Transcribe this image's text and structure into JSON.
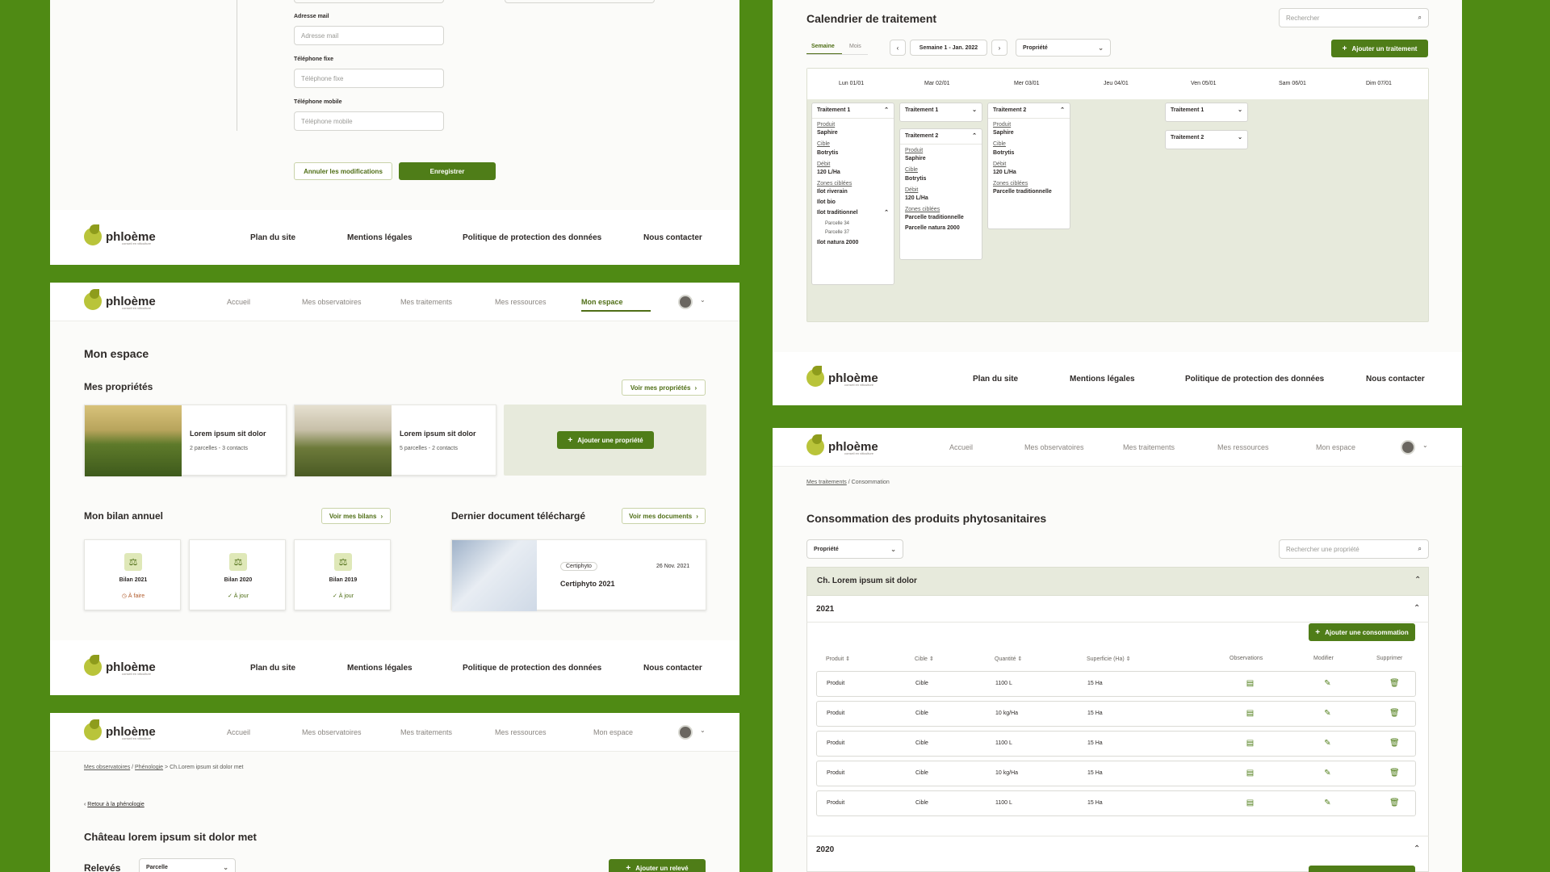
{
  "colors": {
    "background": "#4f8a14",
    "accent": "#4f7d18"
  },
  "brand": {
    "name": "phloème",
    "tagline": "conseil en viticulture"
  },
  "footer": {
    "links": [
      "Plan du site",
      "Mentions légales",
      "Politique de protection des données",
      "Nous contacter"
    ]
  },
  "nav": {
    "links": [
      "Accueil",
      "Mes observatoires",
      "Mes traitements",
      "Mes ressources",
      "Mon espace"
    ],
    "active": "Mon espace"
  },
  "form": {
    "email_label": "Adresse mail",
    "email_placeholder": "Adresse mail",
    "phone_label": "Téléphone fixe",
    "phone_placeholder": "Téléphone fixe",
    "mobile_label": "Téléphone mobile",
    "mobile_placeholder": "Téléphone mobile",
    "cancel": "Annuler les modifications",
    "save": "Enregistrer"
  },
  "espace": {
    "title": "Mon espace",
    "properties_title": "Mes propriétés",
    "see_properties": "Voir mes propriétés",
    "properties": [
      {
        "name": "Lorem ipsum sit dolor",
        "meta": "2 parcelles - 3 contacts"
      },
      {
        "name": "Lorem ipsum sit dolor",
        "meta": "5 parcelles - 2 contacts"
      }
    ],
    "add_property": "Ajouter une propriété",
    "bilan_title": "Mon bilan annuel",
    "see_bilans": "Voir mes bilans",
    "bilans": [
      {
        "name": "Bilan 2021",
        "status": "À faire"
      },
      {
        "name": "Bilan 2020",
        "status": "À jour"
      },
      {
        "name": "Bilan 2019",
        "status": "À jour"
      }
    ],
    "doc_title": "Dernier document téléchargé",
    "see_docs": "Voir mes documents",
    "doc": {
      "tag": "Certiphyto",
      "date": "26 Nov. 2021",
      "name": "Certiphyto 2021"
    }
  },
  "pheno": {
    "breadcrumb": [
      "Mes observatoires",
      "Phénologie",
      "Ch.Lorem ipsum sit dolor met"
    ],
    "back": "Retour à la phénologie",
    "title": "Château lorem ipsum sit dolor met",
    "releves": "Relevés",
    "select": "Parcelle",
    "add": "Ajouter un relevé"
  },
  "calendar": {
    "title": "Calendrier de traitement",
    "search_placeholder": "Rechercher",
    "tab_week": "Semaine",
    "tab_month": "Mois",
    "week_label": "Semaine 1 - Jan. 2022",
    "property_select": "Propriété",
    "add": "Ajouter un traitement",
    "days": [
      "Lun 01/01",
      "Mar 02/01",
      "Mer 03/01",
      "Jeu 04/01",
      "Ven 05/01",
      "Sam 06/01",
      "Dim 07/01"
    ],
    "card1": {
      "title": "Traitement 1",
      "product_label": "Produit",
      "product": "Saphire",
      "target_label": "Cible",
      "target": "Botrytis",
      "rate_label": "Débit",
      "rate": "120 L/Ha",
      "zones_label": "Zones ciblées",
      "zones": [
        "Ilot riverain",
        "Ilot bio",
        "Ilot traditionnel"
      ],
      "parcels": [
        "Parcelle 34",
        "Parcelle 37"
      ],
      "last_zone": "Ilot natura 2000"
    },
    "card2a": {
      "title": "Traitement 1"
    },
    "card2b": {
      "title": "Traitement 2",
      "product_label": "Produit",
      "product": "Saphire",
      "target_label": "Cible",
      "target": "Botrytis",
      "rate_label": "Débit",
      "rate": "120 L/Ha",
      "zones_label": "Zones ciblées",
      "zones": [
        "Parcelle traditionnelle",
        "Parcelle natura 2000"
      ]
    },
    "card3": {
      "title": "Traitement 2",
      "product_label": "Produit",
      "product": "Saphire",
      "target_label": "Cible",
      "target": "Botrytis",
      "rate_label": "Débit",
      "rate": "120 L/Ha",
      "zones_label": "Zones ciblées",
      "zones": [
        "Parcelle traditionnelle"
      ]
    },
    "card5a": {
      "title": "Traitement 1"
    },
    "card5b": {
      "title": "Traitement 2"
    }
  },
  "conso": {
    "breadcrumb": [
      "Mes traitements",
      "Consommation"
    ],
    "title": "Consommation des produits phytosanitaires",
    "select": "Propriété",
    "search_placeholder": "Rechercher une propriété",
    "group": "Ch. Lorem ipsum sit dolor",
    "year1": "2021",
    "year2": "2020",
    "add": "Ajouter une consommation",
    "headers": [
      "Produit",
      "Cible",
      "Quantité",
      "Superficie (Ha)",
      "Observations",
      "Modifier",
      "Supprimer"
    ],
    "rows": [
      [
        "Produit",
        "Cible",
        "1100 L",
        "15 Ha"
      ],
      [
        "Produit",
        "Cible",
        "10 kg/Ha",
        "15 Ha"
      ],
      [
        "Produit",
        "Cible",
        "1100 L",
        "15 Ha"
      ],
      [
        "Produit",
        "Cible",
        "10 kg/Ha",
        "15 Ha"
      ],
      [
        "Produit",
        "Cible",
        "1100 L",
        "15 Ha"
      ]
    ]
  }
}
